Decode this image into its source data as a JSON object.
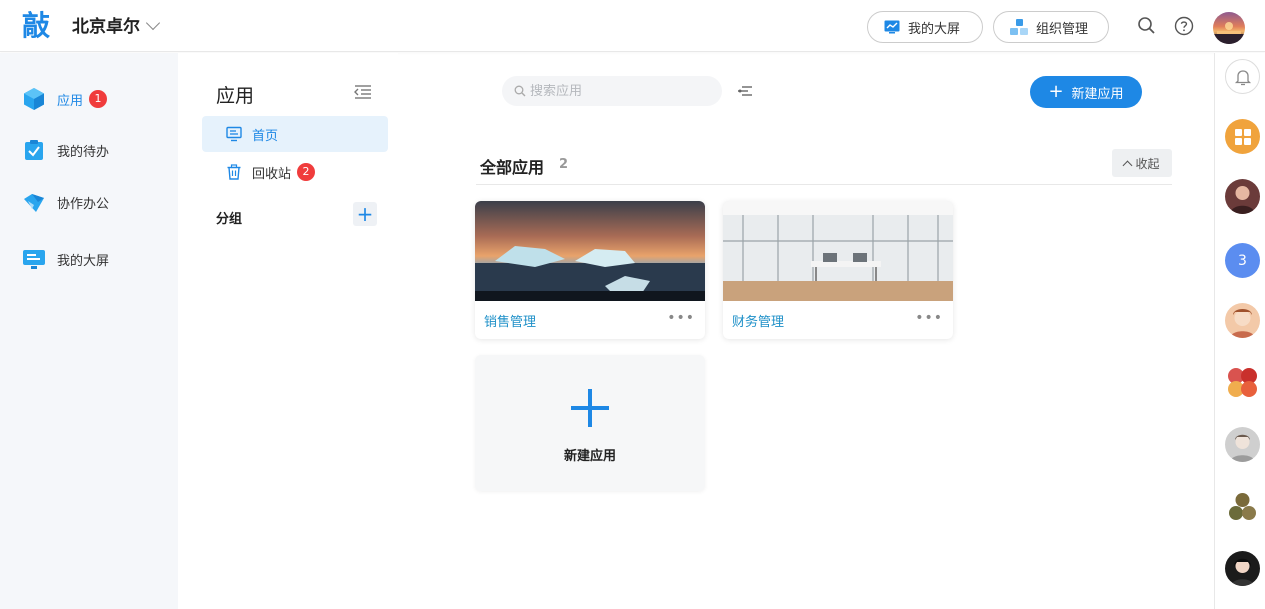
{
  "header": {
    "logo": "敲",
    "org_name": "北京卓尔",
    "buttons": [
      {
        "label": "我的大屏",
        "icon": "dashboard-icon"
      },
      {
        "label": "组织管理",
        "icon": "org-icon"
      }
    ]
  },
  "leftnav": {
    "items": [
      {
        "label": "应用",
        "icon": "cube-icon",
        "badge": "1",
        "active": true
      },
      {
        "label": "我的待办",
        "icon": "todo-icon"
      },
      {
        "label": "协作办公",
        "icon": "collab-icon"
      },
      {
        "label": "我的大屏",
        "icon": "screen-icon"
      }
    ]
  },
  "subnav": {
    "title": "应用",
    "items": [
      {
        "label": "首页",
        "icon": "monitor-icon",
        "active": true
      },
      {
        "label": "回收站",
        "icon": "trash-icon",
        "badge": "2"
      }
    ],
    "group_title": "分组"
  },
  "main": {
    "search_placeholder": "搜索应用",
    "new_app_label": "新建应用",
    "section_title": "全部应用",
    "section_count": "2",
    "collapse_label": "收起",
    "apps": [
      {
        "name": "销售管理",
        "more": "•••"
      },
      {
        "name": "财务管理",
        "more": "•••"
      }
    ],
    "new_card_label": "新建应用"
  },
  "rail": {
    "count_badge": "3"
  },
  "colors": {
    "accent": "#1e88e5",
    "badge": "#f03c3c",
    "app_name": "#1e90c8"
  }
}
